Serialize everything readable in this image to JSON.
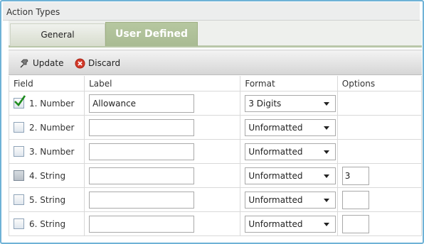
{
  "panel": {
    "title": "Action Types"
  },
  "tabs": [
    {
      "label": "General",
      "active": false
    },
    {
      "label": "User Defined",
      "active": true
    }
  ],
  "toolbar": {
    "update_label": "Update",
    "discard_label": "Discard"
  },
  "columns": {
    "field": "Field",
    "label": "Label",
    "format": "Format",
    "options": "Options"
  },
  "rows": [
    {
      "field": "1. Number",
      "checked": true,
      "label_value": "Allowance",
      "format": "3 Digits",
      "options_value": null
    },
    {
      "field": "2. Number",
      "checked": false,
      "label_value": "",
      "format": "Unformatted",
      "options_value": null
    },
    {
      "field": "3. Number",
      "checked": false,
      "label_value": "",
      "format": "Unformatted",
      "options_value": null
    },
    {
      "field": "4. String",
      "checked": false,
      "label_value": "",
      "format": "Unformatted",
      "options_value": "3"
    },
    {
      "field": "5. String",
      "checked": false,
      "label_value": "",
      "format": "Unformatted",
      "options_value": ""
    },
    {
      "field": "6. String",
      "checked": false,
      "label_value": "",
      "format": "Unformatted",
      "options_value": ""
    }
  ],
  "colors": {
    "frame_border": "#6fb2d6",
    "active_tab": "#aebf98",
    "check_green": "#1f8c1f",
    "discard_red": "#d23a2a"
  }
}
